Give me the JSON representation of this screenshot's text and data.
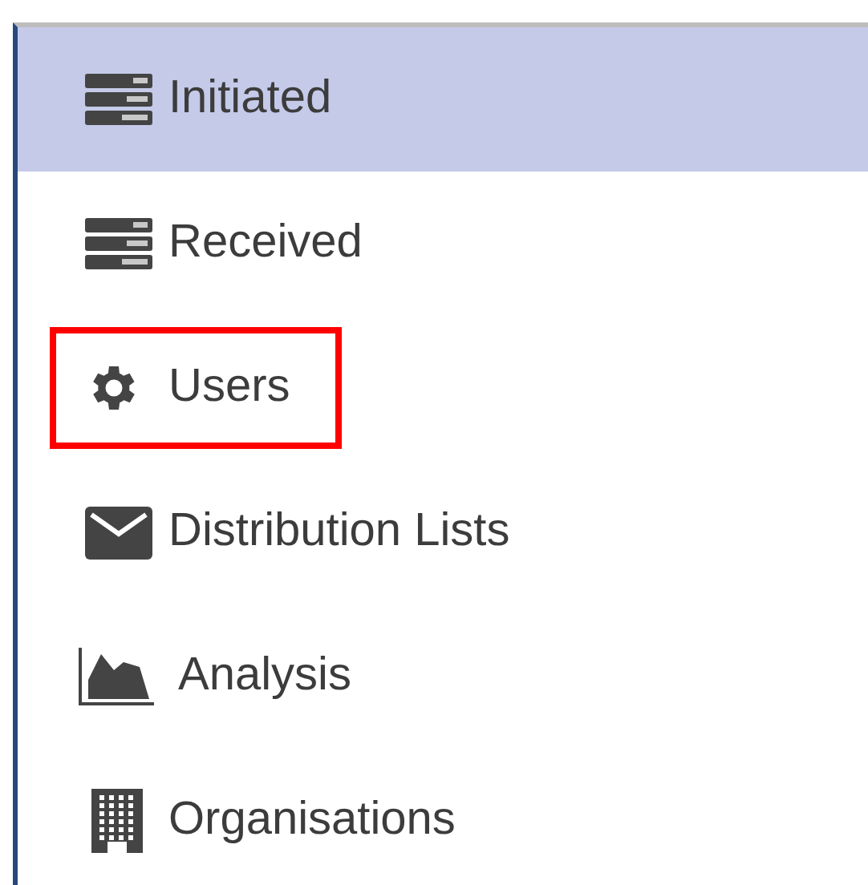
{
  "menu": {
    "items": [
      {
        "label": "Initiated",
        "kind": "server",
        "selected": true,
        "highlighted": false
      },
      {
        "label": "Received",
        "kind": "server",
        "selected": false,
        "highlighted": false
      },
      {
        "label": "Users",
        "kind": "gear",
        "selected": false,
        "highlighted": true
      },
      {
        "label": "Distribution Lists",
        "kind": "envelope",
        "selected": false,
        "highlighted": false
      },
      {
        "label": "Analysis",
        "kind": "chart",
        "selected": false,
        "highlighted": false
      },
      {
        "label": "Organisations",
        "kind": "building",
        "selected": false,
        "highlighted": false
      }
    ]
  }
}
